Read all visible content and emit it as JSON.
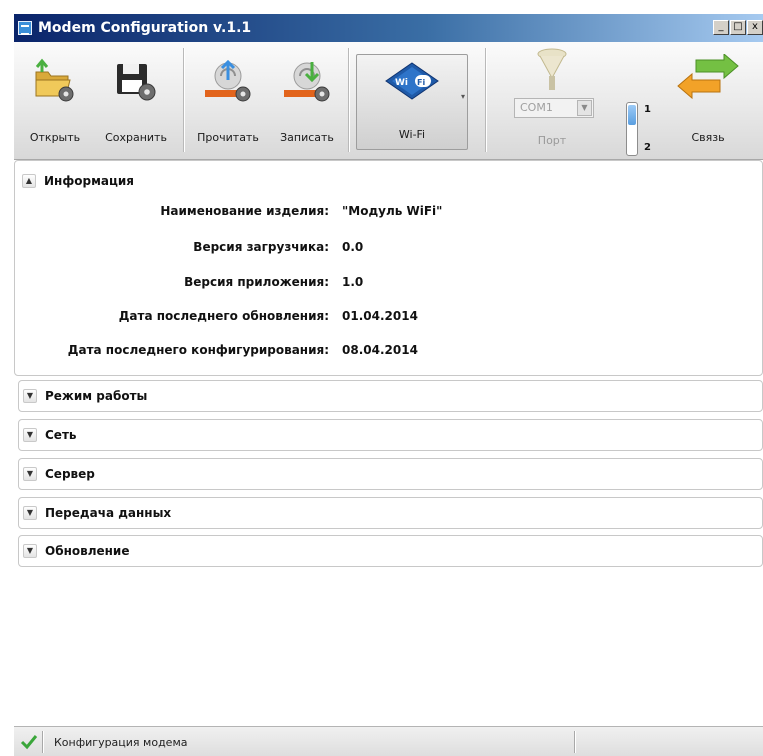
{
  "window": {
    "title": "Modem Configuration v.1.1",
    "controls": {
      "minimize": "_",
      "maximize": "□",
      "close": "x"
    }
  },
  "toolbar": {
    "open_label": "Открыть",
    "save_label": "Сохранить",
    "read_label": "Прочитать",
    "write_label": "Записать",
    "wifi_label": "Wi-Fi",
    "wifi_badge": "WiFi",
    "port_label": "Порт",
    "port_value": "COM1",
    "slider_top_label": "1",
    "slider_bottom_label": "2",
    "connect_label": "Связь"
  },
  "info_section": {
    "title": "Информация",
    "rows": [
      {
        "key": "Наименование изделия:",
        "value": "\"Модуль WiFi\""
      },
      {
        "key": "Версия загрузчика:",
        "value": "0.0"
      },
      {
        "key": "Версия приложения:",
        "value": "1.0"
      },
      {
        "key": "Дата последнего обновления:",
        "value": "01.04.2014"
      },
      {
        "key": "Дата последнего конфигурирования:",
        "value": "08.04.2014"
      }
    ]
  },
  "sections": [
    {
      "title": "Режим работы"
    },
    {
      "title": "Сеть"
    },
    {
      "title": "Сервер"
    },
    {
      "title": "Передача данных"
    },
    {
      "title": "Обновление"
    }
  ],
  "status": {
    "text": "Конфигурация модема"
  },
  "icons": {
    "app": "modem-icon",
    "open": "folder-gear-icon",
    "save": "floppy-gear-icon",
    "read": "satellite-read-icon",
    "write": "satellite-write-icon",
    "wifi": "wifi-icon",
    "port": "port-antenna-icon",
    "connect": "connection-arrows-icon",
    "status": "checkmark-icon"
  },
  "colors": {
    "title_bar": "#0a246a",
    "accent": "#3b8fd9",
    "status_check": "#3aa63a"
  }
}
